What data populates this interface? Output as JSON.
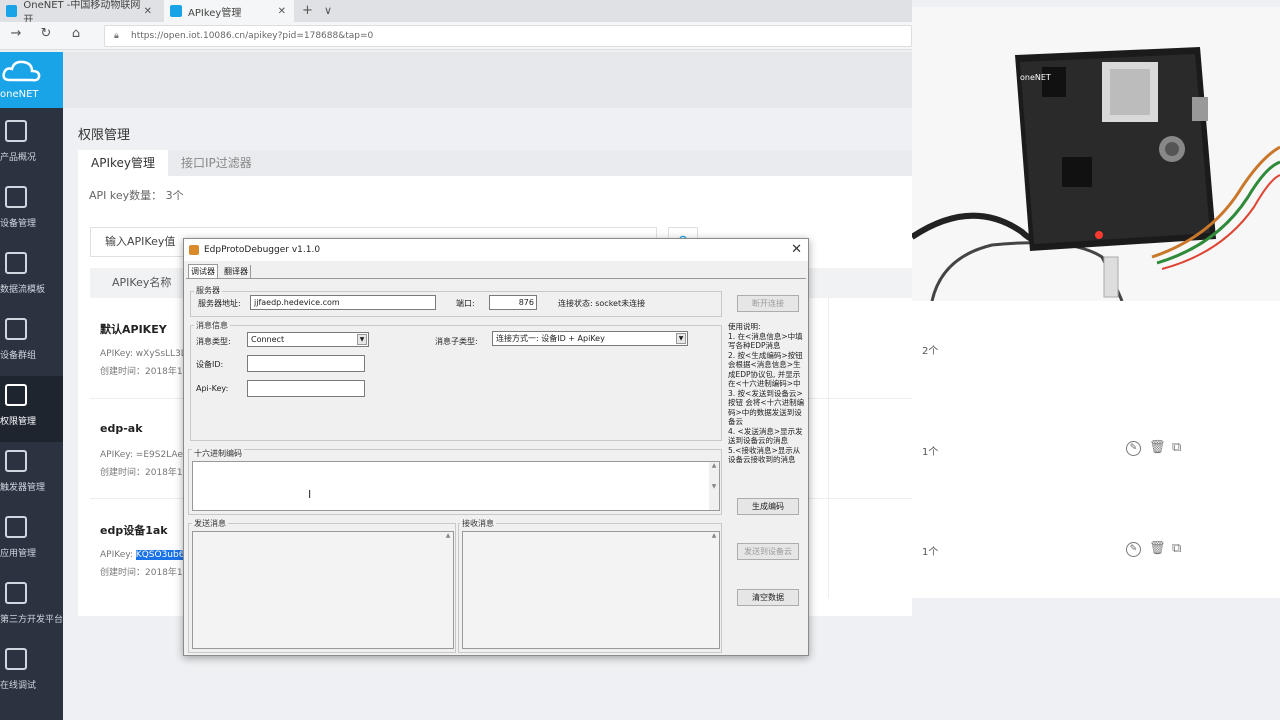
{
  "browser": {
    "tabs": [
      {
        "label": "OneNET -中国移动物联网开"
      },
      {
        "label": "APIkey管理"
      }
    ],
    "url": "https://open.iot.10086.cn/apikey?pid=178688&tap=0",
    "new_tab": "+",
    "tab_menu": "∨",
    "close": "✕"
  },
  "logo": {
    "text": "oneNET"
  },
  "sidebar": {
    "items": [
      {
        "label": "产品概况"
      },
      {
        "label": "设备管理"
      },
      {
        "label": "数据流模板"
      },
      {
        "label": "设备群组"
      },
      {
        "label": "权限管理"
      },
      {
        "label": "触发器管理"
      },
      {
        "label": "应用管理"
      },
      {
        "label": "第三方开发平台"
      },
      {
        "label": "在线调试"
      }
    ]
  },
  "page": {
    "title": "权限管理",
    "tabs": [
      "APIkey管理",
      "接口IP过滤器"
    ],
    "count_text": "API key数量： 3个",
    "search_placeholder": "输入APIKey值",
    "col_name": "APIKey名称"
  },
  "keys": [
    {
      "name": "默认APIKEY",
      "key": "APIKey: wXySsLL3L",
      "time": "创建时间：2018年1",
      "count": "2个"
    },
    {
      "name": "edp-ak",
      "key": "APIKey: =E9S2LAeZ",
      "time": "创建时间：2018年1",
      "count": "1个"
    },
    {
      "name": "edp设备1ak",
      "key_prefix": "APIKey: ",
      "key_sel": "KQSO3ub6",
      "time": "创建时间：2018年1",
      "count": "1个"
    }
  ],
  "dialog": {
    "title": "EdpProtoDebugger v1.1.0",
    "tabs": [
      "调试器",
      "翻译器"
    ],
    "server_group": "服务器",
    "server_addr_label": "服务器地址:",
    "server_addr": "jjfaedp.hedevice.com",
    "port_label": "端口:",
    "port": "876",
    "conn_status": "连接状态: socket未连接",
    "disconnect_btn": "断开连接",
    "msg_group": "消息信息",
    "msg_type_label": "消息类型:",
    "msg_type": "Connect",
    "msg_subtype_label": "消息子类型:",
    "msg_subtype": "连接方式一: 设备ID + ApiKey",
    "device_id_label": "设备ID:",
    "apikey_label": "Api-Key:",
    "help_text": "使用说明:\n1. 在<消息信息>中填写各种EDP消息\n2. 按<生成编码>按钮 会根据<消息信息>生成EDP协议包, 并显示在<十六进制编码>中\n3. 按<发送到设备云>按钮 会将<十六进制编码>中的数据发送到设备云\n4. <发送消息>显示发送到设备云的消息\n5.<接收消息>显示从设备云接收到的消息",
    "hex_group": "十六进制编码",
    "gen_btn": "生成编码",
    "send_group": "发送消息",
    "recv_group": "接收消息",
    "send_btn": "发送到设备云",
    "clear_btn": "清空数据"
  }
}
